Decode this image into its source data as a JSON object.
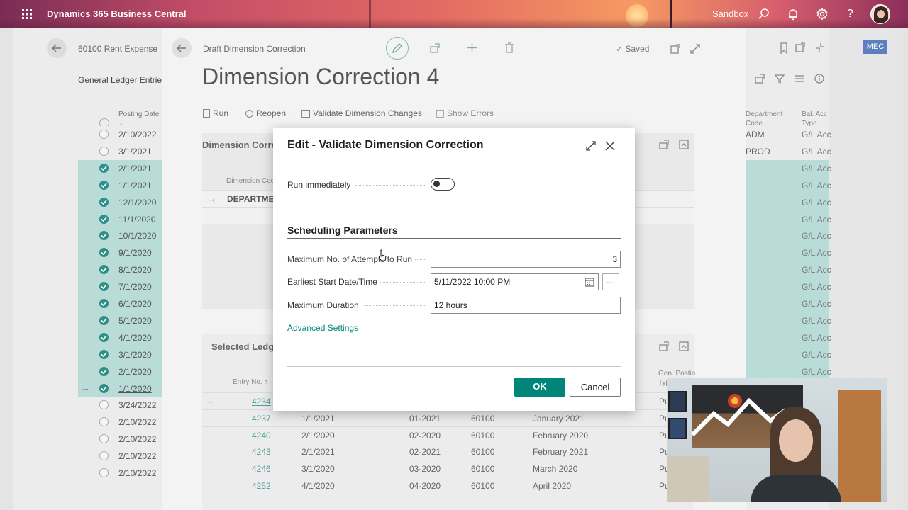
{
  "app": {
    "title": "Dynamics 365 Business Central",
    "environment": "Sandbox",
    "user_badge": "MEC"
  },
  "back_page": {
    "breadcrumb": "60100 Rent Expense",
    "section_title": "General Ledger Entrie",
    "column_posting_date": "Posting Date",
    "sort_arrow": "↓",
    "rows": [
      {
        "date": "2/10/2022",
        "checked": false
      },
      {
        "date": "3/1/2021",
        "checked": false
      },
      {
        "date": "2/1/2021",
        "checked": true
      },
      {
        "date": "1/1/2021",
        "checked": true
      },
      {
        "date": "12/1/2020",
        "checked": true
      },
      {
        "date": "11/1/2020",
        "checked": true
      },
      {
        "date": "10/1/2020",
        "checked": true
      },
      {
        "date": "9/1/2020",
        "checked": true
      },
      {
        "date": "8/1/2020",
        "checked": true
      },
      {
        "date": "7/1/2020",
        "checked": true
      },
      {
        "date": "6/1/2020",
        "checked": true
      },
      {
        "date": "5/1/2020",
        "checked": true
      },
      {
        "date": "4/1/2020",
        "checked": true
      },
      {
        "date": "3/1/2020",
        "checked": true
      },
      {
        "date": "2/1/2020",
        "checked": true
      },
      {
        "date": "1/1/2020",
        "checked": true
      },
      {
        "date": "3/24/2022",
        "checked": false
      },
      {
        "date": "2/10/2022",
        "checked": false
      },
      {
        "date": "2/10/2022",
        "checked": false
      },
      {
        "date": "2/10/2022",
        "checked": false
      },
      {
        "date": "2/10/2022",
        "checked": false
      }
    ],
    "right_col_dept": "Department\nCode",
    "right_col_acc": "Bal. Acc\nType",
    "right_values": [
      "ADM",
      "PROD"
    ],
    "gl_acc": "G/L Acc"
  },
  "page": {
    "breadcrumb": "Draft Dimension Correction",
    "title": "Dimension Correction 4",
    "saved_label": "Saved",
    "actions": [
      "Run",
      "Reopen",
      "Validate Dimension Changes",
      "Show Errors"
    ],
    "section_dimension": "Dimension Corre",
    "col_dimension_code": "Dimension Cod",
    "dimension_value": "DEPARTMEN",
    "section_selected": "Selected Ledg",
    "col_entry_no": "Entry No. ↑",
    "col_gen_posting": "Gen. Postin\nTyp",
    "entries": [
      {
        "no": "4234",
        "date": "",
        "period": "",
        "acc": "",
        "desc": "",
        "type": "Pu"
      },
      {
        "no": "4237",
        "date": "1/1/2021",
        "period": "01-2021",
        "acc": "60100",
        "desc": "January 2021",
        "type": "Pu"
      },
      {
        "no": "4240",
        "date": "2/1/2020",
        "period": "02-2020",
        "acc": "60100",
        "desc": "February 2020",
        "type": "Pu"
      },
      {
        "no": "4243",
        "date": "2/1/2021",
        "period": "02-2021",
        "acc": "60100",
        "desc": "February 2021",
        "type": "Pu"
      },
      {
        "no": "4246",
        "date": "3/1/2020",
        "period": "03-2020",
        "acc": "60100",
        "desc": "March 2020",
        "type": "Pu"
      },
      {
        "no": "4252",
        "date": "4/1/2020",
        "period": "04-2020",
        "acc": "60100",
        "desc": "April 2020",
        "type": "Pu"
      }
    ]
  },
  "dialog": {
    "title": "Edit - Validate Dimension Correction",
    "run_immediately_label": "Run immediately",
    "run_immediately": false,
    "section_title": "Scheduling Parameters",
    "max_attempts_label": "Maximum No. of Attempts to Run",
    "max_attempts_value": "3",
    "earliest_start_label": "Earliest Start Date/Time",
    "earliest_start_value": "5/11/2022 10:00 PM",
    "max_duration_label": "Maximum Duration",
    "max_duration_value": "12 hours",
    "advanced_link": "Advanced Settings",
    "ok_label": "OK",
    "cancel_label": "Cancel"
  },
  "colors": {
    "accent": "#008575",
    "teal_selection": "#b9dcd9",
    "link": "#00857a"
  }
}
